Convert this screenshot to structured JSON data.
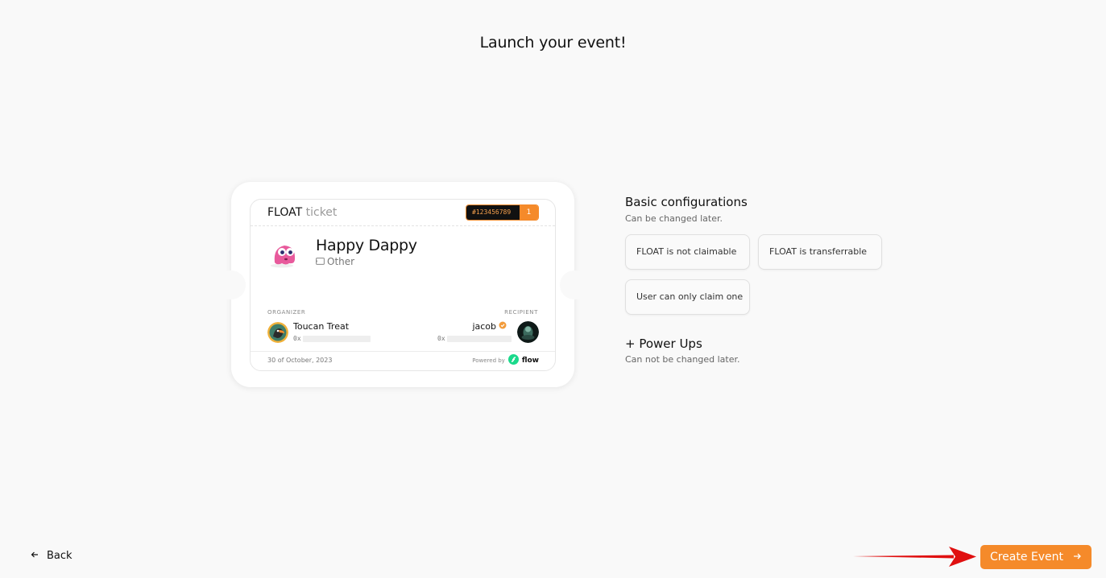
{
  "page": {
    "title": "Launch your event!"
  },
  "ticket": {
    "brand": "FLOAT",
    "brand_suffix": "ticket",
    "serial": "#123456789",
    "count": "1",
    "event_name": "Happy Dappy",
    "event_type": "Other",
    "event_type_icon": "ticket-icon",
    "organizer_label": "ORGANIZER",
    "organizer_name": "Toucan Treat",
    "organizer_address_prefix": "0x",
    "recipient_label": "RECIPIENT",
    "recipient_name": "jacob",
    "recipient_address_prefix": "0x",
    "verified_icon": "verified-badge-icon",
    "date": "30 of October, 2023",
    "powered_by": "Powered by",
    "flow_label": "flow"
  },
  "config": {
    "title": "Basic configurations",
    "subtitle": "Can be changed later.",
    "options": [
      {
        "label": "FLOAT is not claimable"
      },
      {
        "label": "FLOAT is transferrable"
      },
      {
        "label": "User can only claim one"
      }
    ]
  },
  "power_ups": {
    "title": "+ Power Ups",
    "subtitle": "Can not be changed later."
  },
  "nav": {
    "back_label": "Back",
    "back_icon": "arrow-left-icon",
    "create_label": "Create Event",
    "create_icon": "arrow-right-icon"
  },
  "colors": {
    "accent": "#f58a2a",
    "background": "#f9f9f9",
    "annotation_arrow": "#e01010"
  }
}
